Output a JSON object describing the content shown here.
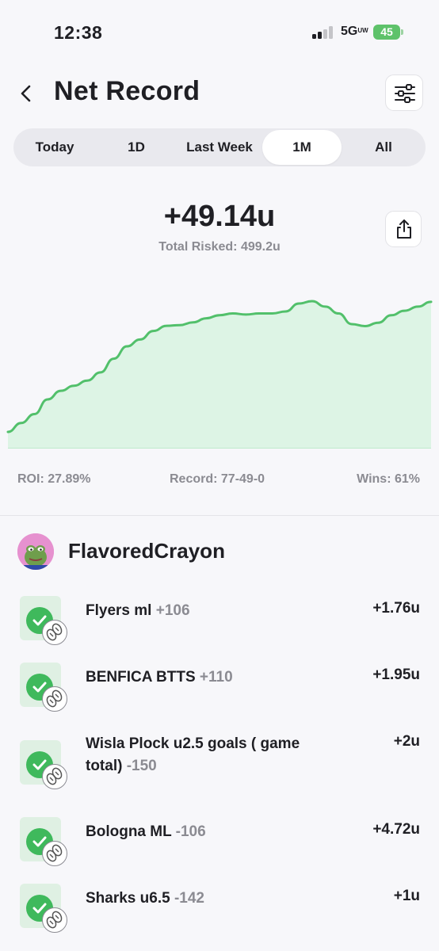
{
  "status_bar": {
    "time": "12:38",
    "network": "5G",
    "network_sup": "UW",
    "battery": "45"
  },
  "header": {
    "title": "Net Record",
    "back_icon": "chevron-left-icon",
    "filter_icon": "sliders-icon"
  },
  "range_tabs": [
    {
      "label": "Today",
      "active": false
    },
    {
      "label": "1D",
      "active": false
    },
    {
      "label": "Last Week",
      "active": false
    },
    {
      "label": "1M",
      "active": true
    },
    {
      "label": "All",
      "active": false
    }
  ],
  "summary": {
    "net_units": "+49.14u",
    "total_risked": "Total Risked: 499.2u",
    "share_icon": "share-icon"
  },
  "chart_data": {
    "type": "area",
    "title": "",
    "xlabel": "",
    "ylabel": "",
    "series": [
      {
        "values": [
          0,
          2.6,
          5.2,
          9.5,
          12.0,
          13.5,
          15.0,
          17.4,
          21.4,
          25.0,
          27.0,
          29.5,
          31.0,
          31.2,
          32.0,
          33.2,
          34.1,
          34.6,
          34.3,
          34.6,
          34.6,
          35.2,
          37.5,
          38.2,
          36.6,
          34.6,
          31.5,
          30.9,
          31.9,
          34.1,
          35.4,
          36.6,
          38.0
        ]
      }
    ],
    "line_color": "#52c06b",
    "fill_color": "#ddf4e5",
    "grid": false
  },
  "stats": {
    "roi": "ROI: 27.89%",
    "record": "Record: 77-49-0",
    "wins": "Wins: 61%"
  },
  "profile": {
    "username": "FlavoredCrayon",
    "avatar_icon": "frog-avatar-icon"
  },
  "bets": [
    {
      "title": "Flyers ml",
      "odds": "+106",
      "result": "+1.76u"
    },
    {
      "title": "BENFICA BTTS",
      "odds": "+110",
      "result": "+1.95u"
    },
    {
      "title": "Wisla Plock u2.5 goals ( game total)",
      "odds": "-150",
      "result": "+2u"
    },
    {
      "title": "Bologna ML",
      "odds": "-106",
      "result": "+4.72u"
    },
    {
      "title": "Sharks u6.5",
      "odds": "-142",
      "result": "+1u"
    }
  ],
  "colors": {
    "accent_green": "#3fb95c",
    "muted_text": "#8b8b92",
    "badge_bg": "#dff0e3"
  }
}
